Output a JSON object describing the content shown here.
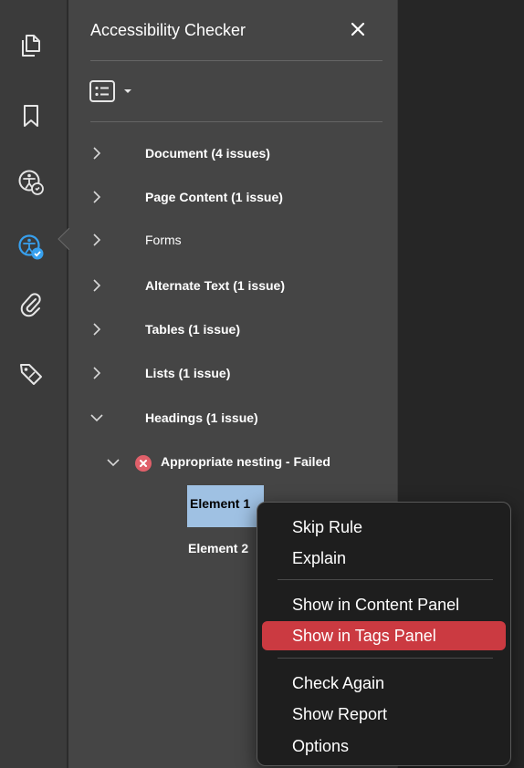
{
  "rail": {
    "icons": [
      "pages-icon",
      "bookmark-icon",
      "accessibility-icon",
      "accessibility-check-icon",
      "attachment-icon",
      "tag-icon"
    ]
  },
  "panel": {
    "title": "Accessibility Checker",
    "close_icon": "close-icon",
    "options_icon": "list-options-icon"
  },
  "tree": {
    "items": [
      {
        "label": "Document (4 issues)",
        "expanded": false,
        "bold": true
      },
      {
        "label": "Page Content (1 issue)",
        "expanded": false,
        "bold": true
      },
      {
        "label": "Forms",
        "expanded": false,
        "bold": false
      },
      {
        "label": "Alternate Text (1 issue)",
        "expanded": false,
        "bold": true
      },
      {
        "label": "Tables (1 issue)",
        "expanded": false,
        "bold": true
      },
      {
        "label": "Lists (1 issue)",
        "expanded": false,
        "bold": true
      },
      {
        "label": "Headings (1 issue)",
        "expanded": true,
        "bold": true
      }
    ],
    "rule": {
      "label": "Appropriate nesting - Failed",
      "status": "failed"
    },
    "elements": [
      "Element 1",
      "Element 2"
    ]
  },
  "context_menu": {
    "groups": [
      [
        "Skip Rule",
        "Explain"
      ],
      [
        "Show in Content Panel",
        "Show in Tags Panel"
      ],
      [
        "Check Again",
        "Show Report",
        "Options"
      ]
    ],
    "highlighted": "Show in Tags Panel"
  },
  "colors": {
    "panel_bg": "#454545",
    "rail_bg": "#3b3b3b",
    "selection": "#9fc1e3",
    "menu_highlight": "#cb3a41",
    "accent_blue": "#37a0ee",
    "fail_red": "#e0606a"
  }
}
